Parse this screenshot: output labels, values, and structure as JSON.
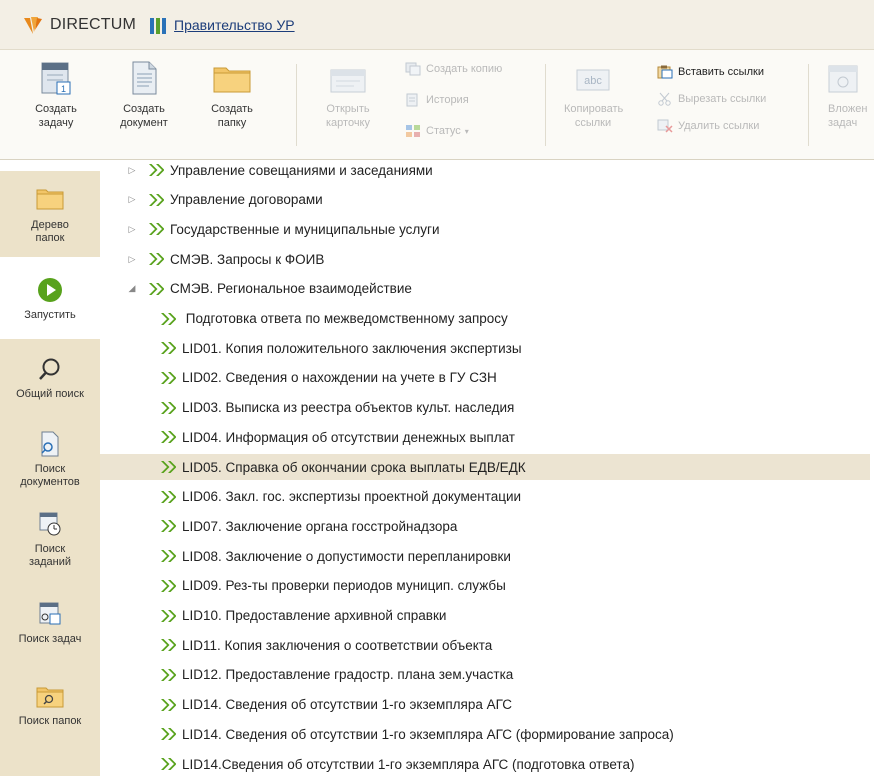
{
  "titlebar": {
    "app_name": "DIRECTUM",
    "org_link": "Правительство УР"
  },
  "ribbon": {
    "create_task": "Создать задачу",
    "create_document": "Создать документ",
    "create_folder": "Создать папку",
    "open_card": "Открыть карточку",
    "create_copy": "Создать копию",
    "history": "История",
    "status": "Статус",
    "copy_links": "Копировать ссылки",
    "paste_links": "Вставить ссылки",
    "cut_links": "Вырезать ссылки",
    "delete_links": "Удалить ссылки",
    "attach_task": "Вложен задач"
  },
  "leftnav": {
    "folder_tree": "Дерево папок",
    "run": "Запустить",
    "global_search": "Общий поиск",
    "doc_search": "Поиск документов",
    "job_search": "Поиск заданий",
    "task_search": "Поиск задач",
    "folder_search": "Поиск папок"
  },
  "tree": {
    "rows": [
      {
        "text": "Управление совещаниями и заседаниями",
        "level": 0,
        "toggle": "▷"
      },
      {
        "text": "Управление договорами",
        "level": 0,
        "toggle": "▷"
      },
      {
        "text": "Государственные и муниципальные услуги",
        "level": 0,
        "toggle": "▷"
      },
      {
        "text": "СМЭВ. Запросы к ФОИВ",
        "level": 0,
        "toggle": "▷"
      },
      {
        "text": "СМЭВ. Региональное взаимодействие",
        "level": 0,
        "toggle": "◢"
      },
      {
        "text": " Подготовка ответа по межведомственному запросу",
        "level": 1
      },
      {
        "text": "LID01. Копия положительного заключения экспертизы",
        "level": 1
      },
      {
        "text": "LID02. Сведения о нахождении на учете в ГУ СЗН",
        "level": 1
      },
      {
        "text": "LID03. Выписка из реестра объектов культ. наследия",
        "level": 1
      },
      {
        "text": "LID04. Информация об отсутствии денежных выплат",
        "level": 1
      },
      {
        "text": "LID05. Справка об окончании срока выплаты ЕДВ/ЕДК",
        "level": 1,
        "selected": true
      },
      {
        "text": "LID06. Закл. гос. экспертизы проектной документации",
        "level": 1
      },
      {
        "text": "LID07. Заключение органа госстройнадзора",
        "level": 1
      },
      {
        "text": "LID08. Заключение о допустимости перепланировки",
        "level": 1
      },
      {
        "text": "LID09. Рез-ты проверки периодов муницип. службы",
        "level": 1
      },
      {
        "text": "LID10. Предоставление архивной справки",
        "level": 1
      },
      {
        "text": "LID11. Копия заключения о соответствии объекта",
        "level": 1
      },
      {
        "text": "LID12. Предоставление градостр. плана зем.участка",
        "level": 1
      },
      {
        "text": "LID14. Сведения об отсутствии 1-го экземпляра АГС",
        "level": 1
      },
      {
        "text": "LID14. Сведения об отсутствии 1-го экземпляра АГС (формирование запроса)",
        "level": 1
      },
      {
        "text": "LID14.Сведения об отсутствии 1-го экземпляра АГС (подготовка ответа)",
        "level": 1
      }
    ]
  },
  "colors": {
    "accent_green": "#58a21c",
    "selected_row": "#ece4d2",
    "nav_beige": "#ece2c9",
    "logo_orange": "#e8891c"
  }
}
